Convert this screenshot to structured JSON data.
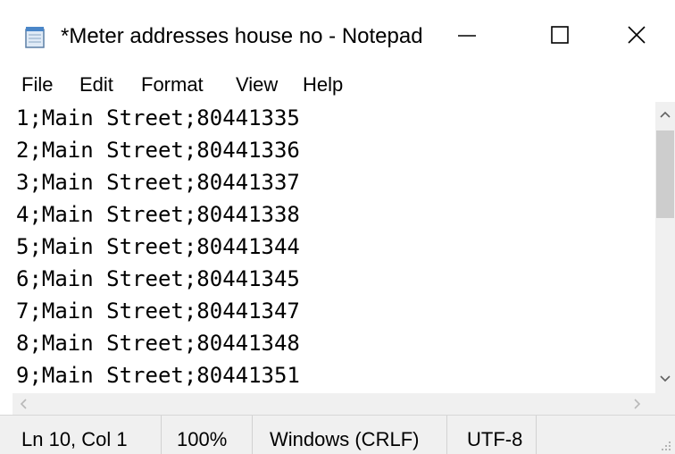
{
  "window": {
    "title": "*Meter addresses house no - Notepad",
    "icon": "notepad-icon",
    "controls": {
      "minimize_icon": "minimize-icon",
      "maximize_icon": "maximize-icon",
      "close_icon": "close-icon"
    }
  },
  "menu": {
    "items": [
      {
        "label": "File"
      },
      {
        "label": "Edit"
      },
      {
        "label": "Format"
      },
      {
        "label": "View"
      },
      {
        "label": "Help"
      }
    ]
  },
  "editor": {
    "lines": [
      "1;Main Street;80441335",
      "2;Main Street;80441336",
      "3;Main Street;80441337",
      "4;Main Street;80441338",
      "5;Main Street;80441344",
      "6;Main Street;80441345",
      "7;Main Street;80441347",
      "8;Main Street;80441348",
      "9;Main Street;80441351"
    ]
  },
  "statusbar": {
    "position": "Ln 10, Col 1",
    "zoom": "100%",
    "line_ending": "Windows (CRLF)",
    "encoding": "UTF-8"
  },
  "colors": {
    "background": "#ffffff",
    "statusbar_bg": "#f0f0f0",
    "scrollbar_thumb": "#cdcdcd"
  }
}
